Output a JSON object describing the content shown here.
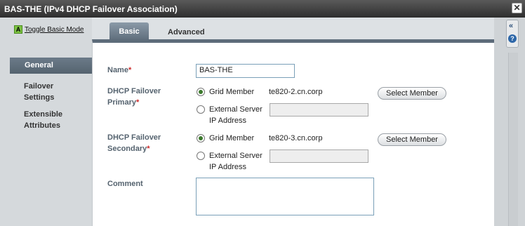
{
  "window": {
    "title": "BAS-THE (IPv4 DHCP Failover Association)",
    "close_glyph": "✕"
  },
  "left_panel": {
    "toggle_icon_letter": "A",
    "toggle_label": "Toggle Basic Mode",
    "nav": [
      {
        "label": "General"
      },
      {
        "label": "Failover\nSettings"
      },
      {
        "label": "Extensible\nAttributes"
      }
    ]
  },
  "tabs": [
    {
      "label": "Basic",
      "active": true
    },
    {
      "label": "Advanced",
      "active": false
    }
  ],
  "right_strip": {
    "collapse_glyph": "«",
    "help_glyph": "?"
  },
  "form": {
    "name_label": "Name",
    "name_value": "BAS-THE",
    "primary": {
      "label_line1": "DHCP Failover",
      "label_line2": "Primary",
      "grid_member_label": "Grid Member",
      "grid_member_value": "te820-2.cn.corp",
      "external_label_line1": "External Server",
      "external_label_line2": "IP Address",
      "select_button": "Select Member"
    },
    "secondary": {
      "label_line1": "DHCP Failover",
      "label_line2": "Secondary",
      "grid_member_label": "Grid Member",
      "grid_member_value": "te820-3.cn.corp",
      "external_label_line1": "External Server",
      "external_label_line2": "IP Address",
      "select_button": "Select Member"
    },
    "comment_label": "Comment",
    "required_mark": "*"
  },
  "colors": {
    "title_bar": "#3a3a3a",
    "nav_active": "#5f6e7b",
    "label_text": "#55636f",
    "required": "#cc2a2a",
    "radio_checked": "#3c7a2d"
  }
}
